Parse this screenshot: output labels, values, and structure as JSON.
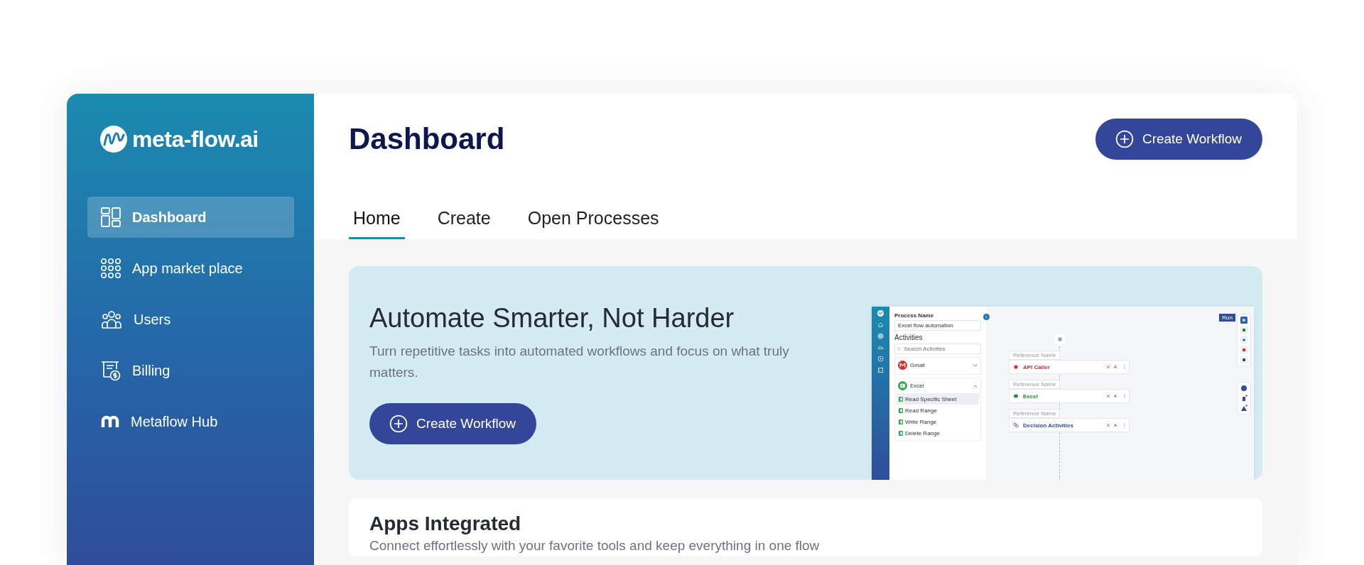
{
  "logo": {
    "text": "meta-flow.ai"
  },
  "sidebar": {
    "items": [
      {
        "label": "Dashboard",
        "kind": "dashboard",
        "selected": true
      },
      {
        "label": "App market place",
        "kind": "apps",
        "selected": false
      },
      {
        "label": "Users",
        "kind": "users",
        "selected": false
      },
      {
        "label": "Billing",
        "kind": "billing",
        "selected": false
      },
      {
        "label": "Metaflow Hub",
        "kind": "hub",
        "selected": false
      }
    ]
  },
  "header": {
    "title": "Dashboard",
    "button": "Create Workflow"
  },
  "tabs": [
    {
      "label": "Home",
      "selected": true
    },
    {
      "label": "Create",
      "selected": false
    },
    {
      "label": "Open Processes",
      "selected": false
    }
  ],
  "banner": {
    "title": "Automate Smarter, Not Harder",
    "subtitle": "Turn repetitive tasks into automated workflows and focus on what truly matters.",
    "button": "Create Workflow"
  },
  "preview": {
    "process_label": "Process Name",
    "process_name": "Excel flow automation",
    "activities_title": "Activities",
    "search_placeholder": "Search Activities",
    "groups": [
      {
        "name": "Gmail",
        "kind": "gmail",
        "expanded": false
      },
      {
        "name": "Excel",
        "kind": "excel",
        "expanded": true,
        "items": [
          {
            "label": "Read Specific Sheet",
            "selected": true
          },
          {
            "label": "Read Range",
            "selected": false
          },
          {
            "label": "Write Range",
            "selected": false
          },
          {
            "label": "Delete Range",
            "selected": false
          }
        ]
      }
    ],
    "run_button": "Run",
    "nodes": [
      {
        "reference": "Reference Name",
        "name": "API Caller",
        "kind": "api"
      },
      {
        "reference": "Reference Name",
        "name": "Excel",
        "kind": "excel"
      },
      {
        "reference": "Reference Name",
        "name": "Decision Activities",
        "kind": "decision"
      }
    ]
  },
  "apps": {
    "title": "Apps Integrated",
    "subtitle": "Connect effortlessly with your favorite tools and keep everything in one flow"
  }
}
